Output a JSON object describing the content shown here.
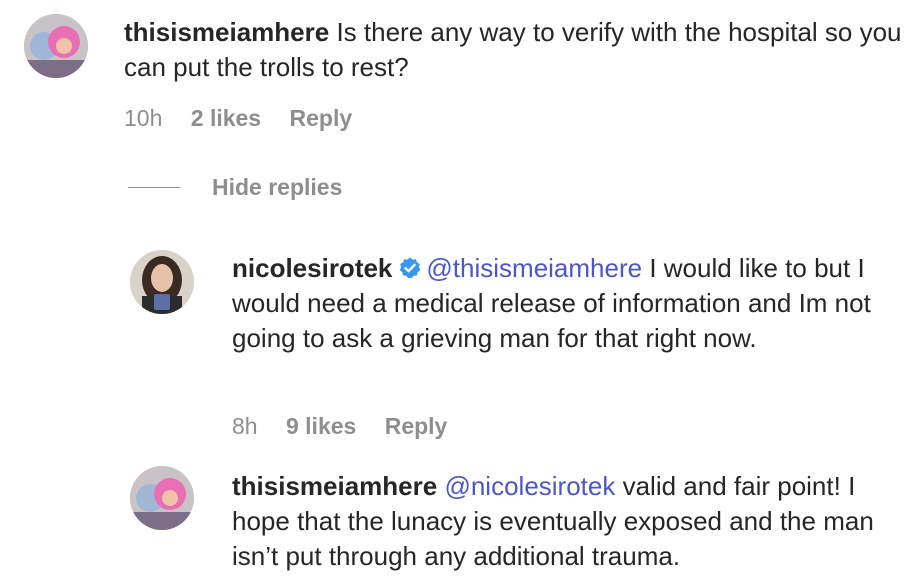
{
  "comments": [
    {
      "username": "thisismeiamhere",
      "mention": "",
      "text": "Is there any way to verify with the hospital so you can put the trolls to rest?",
      "time": "10h",
      "likes": "2 likes",
      "reply": "Reply"
    }
  ],
  "replies_toggle": "Hide replies",
  "replies": [
    {
      "username": "nicolesirotek",
      "verified": true,
      "mention": "@thisismeiamhere",
      "text": "I would like to but I would need a medical release of information and Im not going to ask a grieving man for that right now.",
      "time": "8h",
      "likes": "9 likes",
      "reply": "Reply"
    },
    {
      "username": "thisismeiamhere",
      "mention": "@nicolesirotek",
      "text": "valid and fair point! I hope that the lunacy is eventually exposed and the man isn’t put through any additional trauma."
    }
  ],
  "colors": {
    "mention": "#4b57c9",
    "meta": "#8e8e8e",
    "verified": "#3897f0"
  },
  "icons": {
    "verified": "verified-badge-icon",
    "avatar_pink": "pink-hair-avatar",
    "avatar_dark": "dark-hair-avatar"
  }
}
